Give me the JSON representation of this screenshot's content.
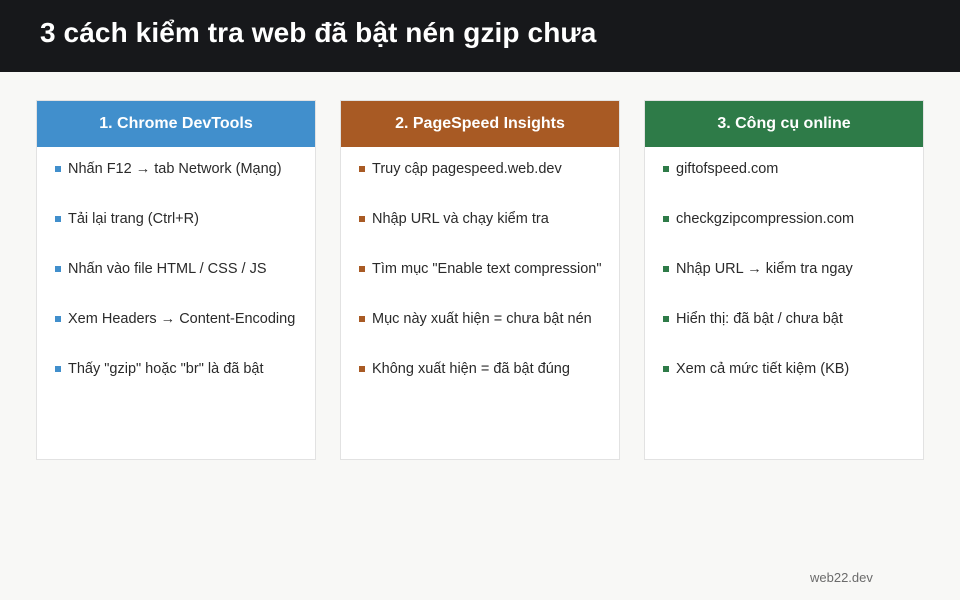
{
  "header": {
    "title": "3 cách kiểm tra web đã bật nén gzip chưa"
  },
  "cards": [
    {
      "title": "1. Chrome DevTools",
      "color": "#418fcc",
      "items": [
        "Nhấn F12 → tab Network (Mạng)",
        "Tải lại trang (Ctrl+R)",
        "Nhấn vào file HTML / CSS / JS",
        "Xem Headers → Content-Encoding",
        "Thấy \"gzip\" hoặc \"br\" là đã bật"
      ]
    },
    {
      "title": "2. PageSpeed Insights",
      "color": "#a85a24",
      "items": [
        "Truy cập pagespeed.web.dev",
        "Nhập URL và chạy kiểm tra",
        "Tìm mục \"Enable text compression\"",
        "Mục này xuất hiện = chưa bật nén",
        "Không xuất hiện = đã bật đúng"
      ]
    },
    {
      "title": "3. Công cụ online",
      "color": "#2e7b48",
      "items": [
        "giftofspeed.com",
        "checkgzipcompression.com",
        "Nhập URL → kiểm tra ngay",
        "Hiển thị: đã bật / chưa bật",
        "Xem cả mức tiết kiệm (KB)"
      ]
    }
  ],
  "footer": {
    "text": "web22.dev"
  }
}
